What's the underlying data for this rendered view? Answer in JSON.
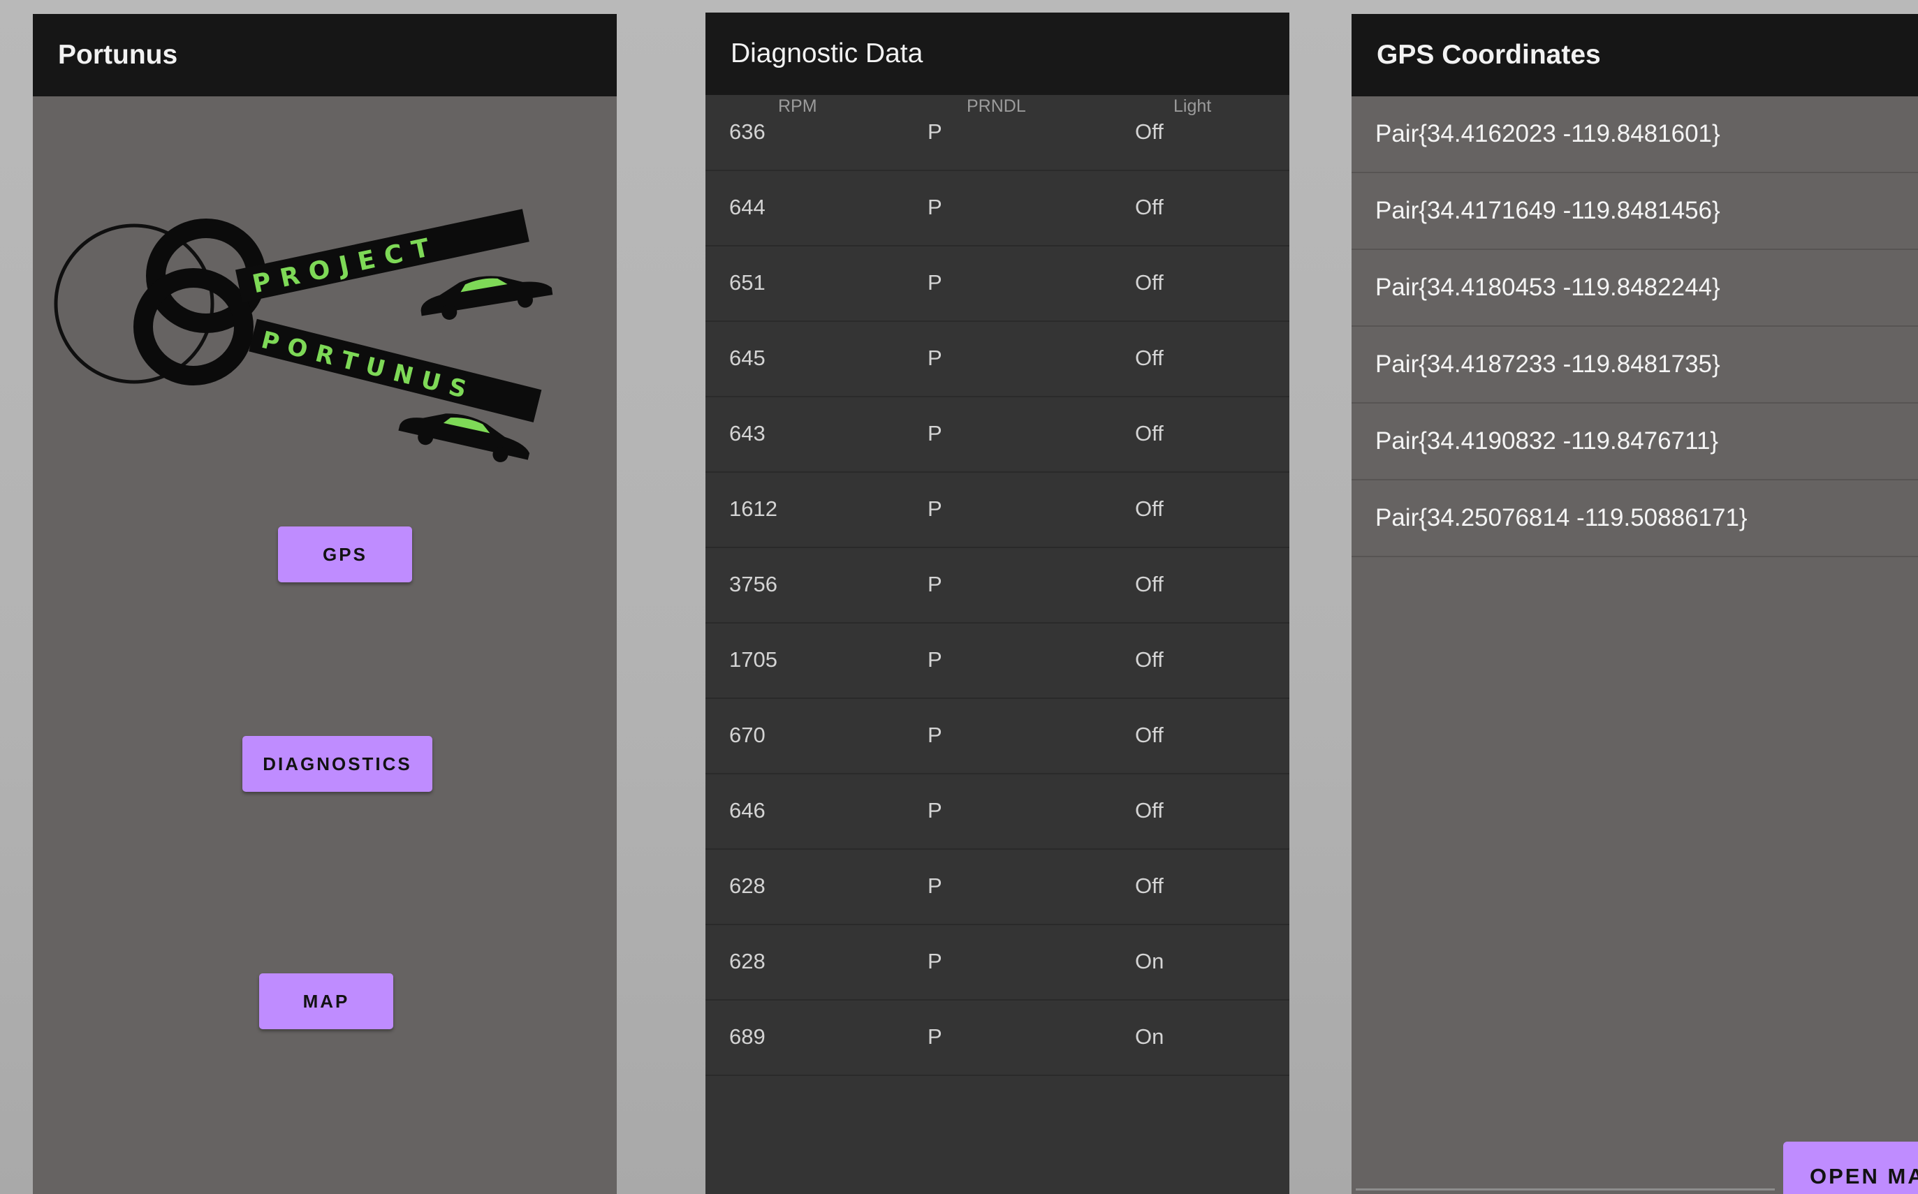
{
  "home": {
    "title": "Portunus",
    "logo": {
      "word_top": "PROJECT",
      "word_bottom": "PORTUNUS"
    },
    "buttons": {
      "gps": "GPS",
      "diagnostics": "DIAGNOSTICS",
      "map": "MAP"
    }
  },
  "diagnostics": {
    "title": "Diagnostic Data",
    "columns": [
      "RPM",
      "PRNDL",
      "Light"
    ],
    "rows": [
      [
        "636",
        "P",
        "Off"
      ],
      [
        "644",
        "P",
        "Off"
      ],
      [
        "651",
        "P",
        "Off"
      ],
      [
        "645",
        "P",
        "Off"
      ],
      [
        "643",
        "P",
        "Off"
      ],
      [
        "1612",
        "P",
        "Off"
      ],
      [
        "3756",
        "P",
        "Off"
      ],
      [
        "1705",
        "P",
        "Off"
      ],
      [
        "670",
        "P",
        "Off"
      ],
      [
        "646",
        "P",
        "Off"
      ],
      [
        "628",
        "P",
        "Off"
      ],
      [
        "628",
        "P",
        "On"
      ],
      [
        "689",
        "P",
        "On"
      ]
    ]
  },
  "gps": {
    "title": "GPS Coordinates",
    "items": [
      "Pair{34.4162023 -119.8481601}",
      "Pair{34.4171649 -119.8481456}",
      "Pair{34.4180453 -119.8482244}",
      "Pair{34.4187233 -119.8481735}",
      "Pair{34.4190832 -119.8476711}",
      "Pair{34.25076814 -119.50886171}"
    ],
    "open_map_label": "OPEN MAP"
  },
  "colors": {
    "accent": "#bf8cff",
    "app_bar": "#161616",
    "surface_home": "#666362",
    "surface_diagnostics": "#343434",
    "logo_green": "#7ed957"
  }
}
